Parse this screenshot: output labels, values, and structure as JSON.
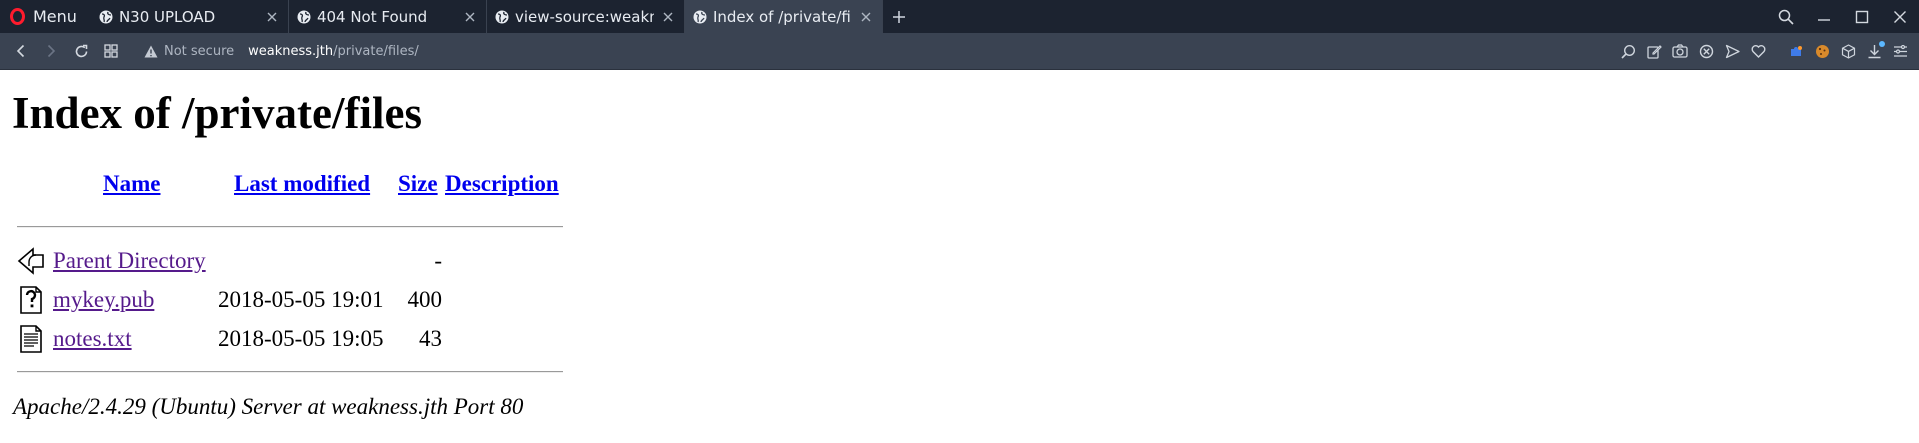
{
  "browser": {
    "menu_label": "Menu",
    "tabs": [
      {
        "title": "N30 UPLOAD",
        "active": false
      },
      {
        "title": "404 Not Found",
        "active": false
      },
      {
        "title": "view-source:weakness.jth/private/",
        "active": false
      },
      {
        "title": "Index of /private/files",
        "active": true
      }
    ],
    "security_label": "Not secure",
    "url_host": "weakness.jth",
    "url_path": "/private/files/",
    "accent_color": "#ff1b2d"
  },
  "page": {
    "heading": "Index of /private/files",
    "columns": {
      "name": "Name",
      "last_modified": "Last modified",
      "size": "Size",
      "description": "Description"
    },
    "rows": [
      {
        "icon": "back-icon",
        "name": "Parent Directory",
        "modified": "",
        "size": "-"
      },
      {
        "icon": "unknown-file-icon",
        "name": "mykey.pub",
        "modified": "2018-05-05 19:01",
        "size": "400"
      },
      {
        "icon": "text-file-icon",
        "name": "notes.txt",
        "modified": "2018-05-05 19:05",
        "size": "43"
      }
    ],
    "footer": "Apache/2.4.29 (Ubuntu) Server at weakness.jth Port 80"
  }
}
